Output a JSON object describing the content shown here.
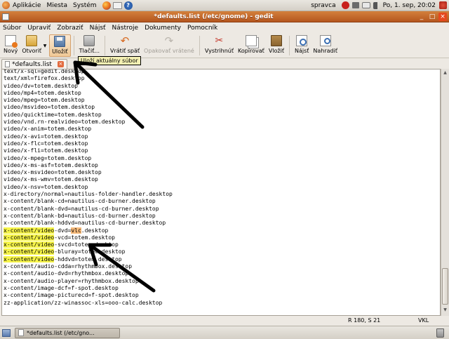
{
  "top_panel": {
    "menus": [
      "Aplikácie",
      "Miesta",
      "Systém"
    ],
    "user": "spravca",
    "clock": "Po, 1. sep, 20:02"
  },
  "window": {
    "title": "*defaults.list (/etc/gnome) - gedit"
  },
  "menubar": {
    "items": [
      "Súbor",
      "Upraviť",
      "Zobraziť",
      "Nájsť",
      "Nástroje",
      "Dokumenty",
      "Pomocník"
    ]
  },
  "toolbar": {
    "new": "Nový",
    "open": "Otvoriť",
    "save": "Uložiť",
    "print": "Tlačiť...",
    "undo": "Vrátiť späť",
    "redo": "Opakovať vrátené",
    "cut": "Vystrihnúť",
    "copy": "Kopírovať",
    "paste": "Vložiť",
    "find": "Nájsť",
    "replace": "Nahradiť"
  },
  "tooltip": "Uloží aktuálny súbor",
  "tab": {
    "label": "*defaults.list"
  },
  "editor": {
    "lines": [
      "text/x-sql=gedit.desktop",
      "text/xml=firefox.desktop",
      "video/dv=totem.desktop",
      "video/mp4=totem.desktop",
      "video/mpeg=totem.desktop",
      "video/msvideo=totem.desktop",
      "video/quicktime=totem.desktop",
      "video/vnd.rn-realvideo=totem.desktop",
      "video/x-anim=totem.desktop",
      "video/x-avi=totem.desktop",
      "video/x-flc=totem.desktop",
      "video/x-fli=totem.desktop",
      "video/x-mpeg=totem.desktop",
      "video/x-ms-asf=totem.desktop",
      "video/x-msvideo=totem.desktop",
      "video/x-ms-wmv=totem.desktop",
      "video/x-nsv=totem.desktop",
      "x-directory/normal=nautilus-folder-handler.desktop",
      "x-content/blank-cd=nautilus-cd-burner.desktop",
      "x-content/blank-dvd=nautilus-cd-burner.desktop",
      "x-content/blank-bd=nautilus-cd-burner.desktop",
      "x-content/blank-hddvd=nautilus-cd-burner.desktop",
      "x-content/video-dvd=vlc.desktop",
      "x-content/video-vcd=totem.desktop",
      "x-content/video-svcd=totem.desktop",
      "x-content/video-bluray=totem.desktop",
      "x-content/video-hddvd=totem.desktop",
      "x-content/audio-cdda=rhythmbox.desktop",
      "x-content/audio-dvd=rhythmbox.desktop",
      "x-content/audio-player=rhythmbox.desktop",
      "x-content/image-dcf=f-spot.desktop",
      "x-content/image-picturecd=f-spot.desktop",
      "zz-application/zz-winassoc-xls=ooo-calc.desktop"
    ],
    "highlight_prefix": "x-content/video",
    "selected_text": "vlc"
  },
  "statusbar": {
    "position": "R 180, S 21",
    "mode": "VKL"
  },
  "taskbar": {
    "task_label": "*defaults.list (/etc/gno..."
  },
  "colors": {
    "highlight": "#f7f54a",
    "selection": "#f7ba7a",
    "titlebar": "#c86b2c"
  }
}
